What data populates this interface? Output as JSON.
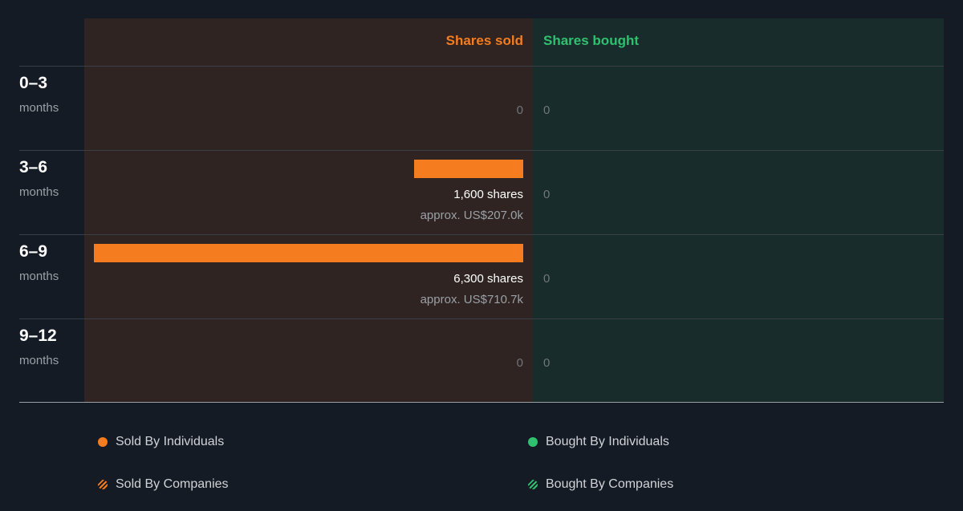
{
  "chart_data": {
    "type": "bar",
    "orientation": "horizontal-diverging",
    "column_headers": {
      "sold": "Shares sold",
      "bought": "Shares bought"
    },
    "rows": [
      {
        "period": "0–3",
        "unit": "months",
        "sold_shares": 0,
        "sold_label": "0",
        "sold_value_label": "",
        "bought_shares": 0,
        "bought_label": "0"
      },
      {
        "period": "3–6",
        "unit": "months",
        "sold_shares": 1600,
        "sold_label": "1,600 shares",
        "sold_value_label": "approx. US$207.0k",
        "bought_shares": 0,
        "bought_label": "0"
      },
      {
        "period": "6–9",
        "unit": "months",
        "sold_shares": 6300,
        "sold_label": "6,300 shares",
        "sold_value_label": "approx. US$710.7k",
        "bought_shares": 0,
        "bought_label": "0"
      },
      {
        "period": "9–12",
        "unit": "months",
        "sold_shares": 0,
        "sold_label": "0",
        "sold_value_label": "",
        "bought_shares": 0,
        "bought_label": "0"
      }
    ],
    "legend": [
      {
        "label": "Sold By Individuals",
        "marker": "dot",
        "color": "#f57c1f"
      },
      {
        "label": "Bought By Individuals",
        "marker": "dot",
        "color": "#2fc16f"
      },
      {
        "label": "Sold By Companies",
        "marker": "hatched-dot",
        "color": "#f57c1f"
      },
      {
        "label": "Bought By Companies",
        "marker": "hatched-dot",
        "color": "#2fc16f"
      }
    ],
    "colors": {
      "sold": "#f57c1f",
      "bought": "#2fc16f",
      "background": "#151b24"
    }
  }
}
